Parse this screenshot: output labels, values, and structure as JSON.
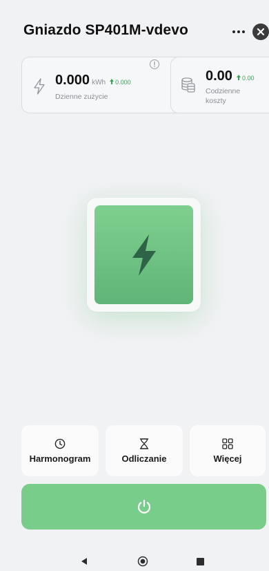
{
  "header": {
    "title": "Gniazdo SP401M-vdevo"
  },
  "stats": {
    "energy": {
      "value": "0.000",
      "unit": "kWh",
      "delta": "0.000",
      "label": "Dzienne zużycie"
    },
    "cost": {
      "value": "0.00",
      "delta": "0.00",
      "label": "Codzienne koszty"
    }
  },
  "actions": {
    "schedule_label": "Harmonogram",
    "countdown_label": "Odliczanie",
    "more_label": "Więcej"
  },
  "colors": {
    "accent_green": "#79cd8a",
    "switch_green": "#5fb577",
    "delta_green": "#3aa35a"
  },
  "icons": {
    "energy": "lightning-outline-icon",
    "cost": "coins-icon",
    "switch": "lightning-bolt-icon",
    "schedule": "clock-icon",
    "countdown": "hourglass-icon",
    "more": "grid-icon",
    "power": "power-icon"
  }
}
